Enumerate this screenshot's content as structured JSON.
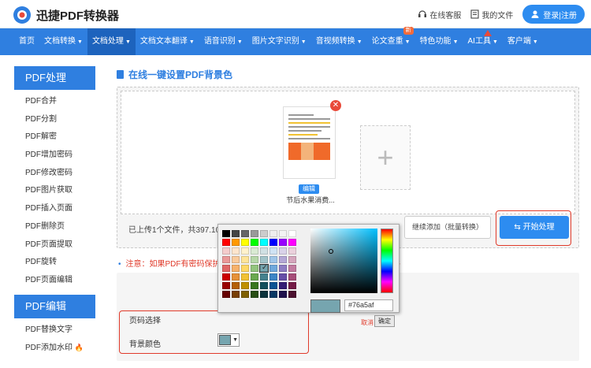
{
  "header": {
    "logo_text": "迅捷PDF转换器",
    "service": "在线客服",
    "my_files": "我的文件",
    "login": "登录|注册"
  },
  "nav": [
    {
      "label": "首页",
      "caret": false
    },
    {
      "label": "文档转换",
      "caret": true
    },
    {
      "label": "文档处理",
      "caret": true,
      "active": true
    },
    {
      "label": "文档文本翻译",
      "caret": true
    },
    {
      "label": "语音识别",
      "caret": true
    },
    {
      "label": "图片文字识别",
      "caret": true
    },
    {
      "label": "音视频转换",
      "caret": true
    },
    {
      "label": "论文查重",
      "caret": true,
      "badge": "新"
    },
    {
      "label": "特色功能",
      "caret": true
    },
    {
      "label": "AI工具",
      "caret": true,
      "badge_icon": "red-triangle"
    },
    {
      "label": "客户端",
      "caret": true
    }
  ],
  "sidebar": {
    "section1": "PDF处理",
    "items1": [
      "PDF合并",
      "PDF分割",
      "PDF解密",
      "PDF增加密码",
      "PDF修改密码",
      "PDF图片获取",
      "PDF插入页面",
      "PDF删除页",
      "PDF页面提取",
      "PDF旋转",
      "PDF页面编辑"
    ],
    "section2": "PDF编辑",
    "items2": [
      "PDF替换文字",
      "PDF添加水印"
    ]
  },
  "main": {
    "title": "在线一键设置PDF背景色",
    "file": {
      "edit": "编辑",
      "name": "节后水果消费..."
    },
    "status": "已上传1个文件，共397.10K。",
    "continue_btn": "继续添加（批量转换）",
    "start_btn": "开始处理",
    "notice": "注意：如果PDF有密码保护",
    "notice_tail": "件",
    "page_select": "页码选择",
    "bg_color": "背景颜色"
  },
  "picker": {
    "hex": "#76a5af",
    "cancel": "取消",
    "ok": "确定",
    "selected_color": "#76a5af"
  },
  "palette": [
    "#000000",
    "#444444",
    "#666666",
    "#999999",
    "#cccccc",
    "#eeeeee",
    "#f3f3f3",
    "#ffffff",
    "#ff0000",
    "#ff9900",
    "#ffff00",
    "#00ff00",
    "#00ffff",
    "#0000ff",
    "#9900ff",
    "#ff00ff",
    "#f4cccc",
    "#fce5cd",
    "#fff2cc",
    "#d9ead3",
    "#d0e0e3",
    "#cfe2f3",
    "#d9d2e9",
    "#ead1dc",
    "#ea9999",
    "#f9cb9c",
    "#ffe599",
    "#b6d7a8",
    "#a2c4c9",
    "#9fc5e8",
    "#b4a7d6",
    "#d5a6bd",
    "#e06666",
    "#f6b26b",
    "#ffd966",
    "#93c47d",
    "#76a5af",
    "#6fa8dc",
    "#8e7cc3",
    "#c27ba0",
    "#cc0000",
    "#e69138",
    "#f1c232",
    "#6aa84f",
    "#45818e",
    "#3d85c6",
    "#674ea7",
    "#a64d79",
    "#990000",
    "#b45f06",
    "#bf9000",
    "#38761d",
    "#134f5c",
    "#0b5394",
    "#351c75",
    "#741b47",
    "#660000",
    "#783f04",
    "#7f6000",
    "#274e13",
    "#0c343d",
    "#073763",
    "#20124d",
    "#4c1130"
  ]
}
